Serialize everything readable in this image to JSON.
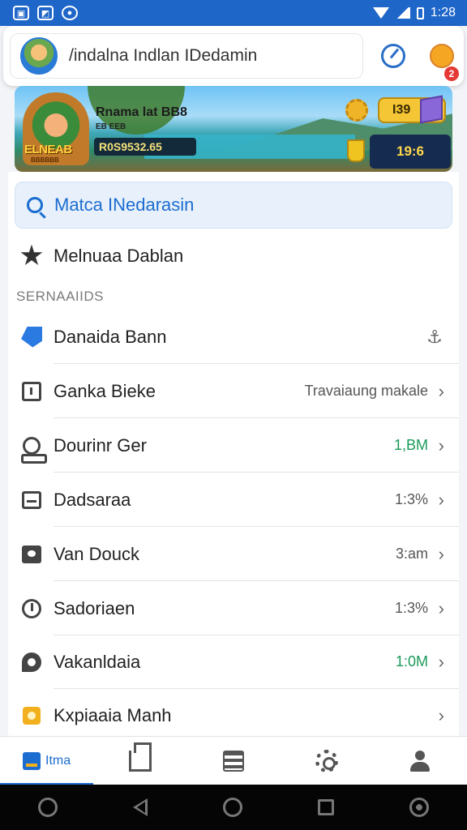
{
  "status_bar": {
    "time": "1:28",
    "left_icons": [
      "sim-icon",
      "photo-icon",
      "notification-icon"
    ],
    "right_icons": [
      "wifi-icon",
      "signal-icon",
      "battery-icon"
    ]
  },
  "header": {
    "search_text": "/indalna Indlan IDedamin",
    "notification_badge": "2",
    "icons": [
      "avatar",
      "compass-icon",
      "bell-icon"
    ]
  },
  "banner": {
    "title": "Rnama lat BB8",
    "subtitle": "EB EEB",
    "stat": "R0S9532.65",
    "game_logo": "ELNEAB",
    "game_logo_sub": "BBBBBB",
    "coins": "I39",
    "gems": "19:6"
  },
  "search": {
    "label": "Matca INedarasin"
  },
  "favorites_row": {
    "label": "Melnuaa Dablan",
    "icon": "star-icon"
  },
  "section": {
    "title": "SERNAAIIDS"
  },
  "items": [
    {
      "label": "Danaida Bann",
      "value": "",
      "icon": "tag-icon",
      "trailing": "anchor"
    },
    {
      "label": "Ganka Bieke",
      "value": "Travaiaung makale",
      "icon": "box-icon",
      "trailing": "chevron"
    },
    {
      "label": "Dourinr Ger",
      "value": "1,BM",
      "icon": "user-icon",
      "trailing": "chevron",
      "value_color": "#1a9a5a"
    },
    {
      "label": "Dadsaraa",
      "value": "1:3%",
      "icon": "tray-icon",
      "trailing": "chevron"
    },
    {
      "label": "Van Douck",
      "value": "3:am",
      "icon": "camera-icon",
      "trailing": "chevron"
    },
    {
      "label": "Sadoriaen",
      "value": "1:3%",
      "icon": "clock-icon",
      "trailing": "chevron"
    },
    {
      "label": "Vakanldaia",
      "value": "1:0M",
      "icon": "chat-icon",
      "trailing": "chevron",
      "value_color": "#1a9a5a"
    },
    {
      "label": "Kxpiaaia Manh",
      "value": "",
      "icon": "square-icon",
      "trailing": "chevron"
    }
  ],
  "bottom_nav": {
    "active_label": "Itma",
    "items": [
      "home-icon",
      "building-icon",
      "list-icon",
      "settings-icon",
      "profile-icon"
    ]
  },
  "system_nav": [
    "assistant-icon",
    "back-icon",
    "home-circle-icon",
    "recents-icon",
    "account-icon"
  ],
  "colors": {
    "accent": "#1c6dd0",
    "status_bar": "#1f66c9",
    "green_value": "#1a9a5a"
  }
}
